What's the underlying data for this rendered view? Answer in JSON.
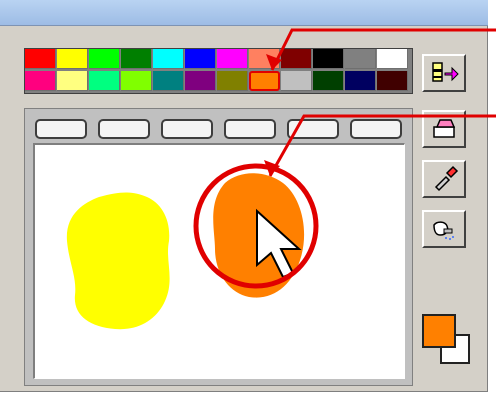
{
  "palette": {
    "colors": [
      [
        "#ff0000",
        "#ffff00",
        "#00ff00",
        "#007f00",
        "#00ffff",
        "#0000ff",
        "#ff00ff",
        "#ff8060",
        "#7f0000",
        "#000000",
        "#808080",
        "#ffffff"
      ],
      [
        "#ff007f",
        "#ffff80",
        "#00ff80",
        "#80ff00",
        "#008080",
        "#7f007f",
        "#808000",
        "#ff8000",
        "#c0c0c0",
        "#003f00",
        "#000060",
        "#400000"
      ]
    ],
    "selected_color": "#ff8000",
    "selected_label": "orange"
  },
  "tool_icons": [
    "fill-bucket-icon",
    "eraser-icon",
    "dropper-icon",
    "spray-icon"
  ],
  "current_colors": {
    "front": "#ff8000",
    "back": "#ffffff"
  },
  "canvas": {
    "shapes": [
      {
        "name": "yellow-blob",
        "color": "#ffff00"
      },
      {
        "name": "orange-blob",
        "color": "#ff8000"
      }
    ]
  },
  "annotation": {
    "line_color": "#e00000",
    "cursor_icon": "arrow-cursor-icon"
  }
}
